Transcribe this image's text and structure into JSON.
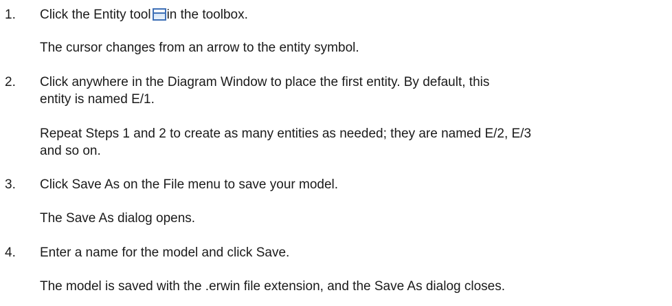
{
  "steps": [
    {
      "number": "1.",
      "text_before_icon": "Click the Entity tool",
      "icon": "entity-tool-icon",
      "text_after_icon": "in the toolbox.",
      "result": "The cursor changes from an arrow to the entity symbol."
    },
    {
      "number": "2.",
      "text_line1": "Click anywhere in the Diagram Window to place the first entity. By default, this",
      "text_line2": "entity is named E/1.",
      "note_line1": "Repeat Steps 1 and 2 to create as many entities as needed; they are named E/2, E/3",
      "note_line2": "and so on."
    },
    {
      "number": "3.",
      "text": "Click Save As on the File menu to save your model.",
      "result": "The Save As dialog opens."
    },
    {
      "number": "4.",
      "text": "Enter a name for the model and click Save.",
      "result": "The model is saved with the .erwin file extension, and the Save As dialog closes."
    }
  ],
  "colors": {
    "text": "#1a1a1a",
    "icon_border": "#3d6fb6",
    "icon_fill": "#d7e6f7"
  }
}
